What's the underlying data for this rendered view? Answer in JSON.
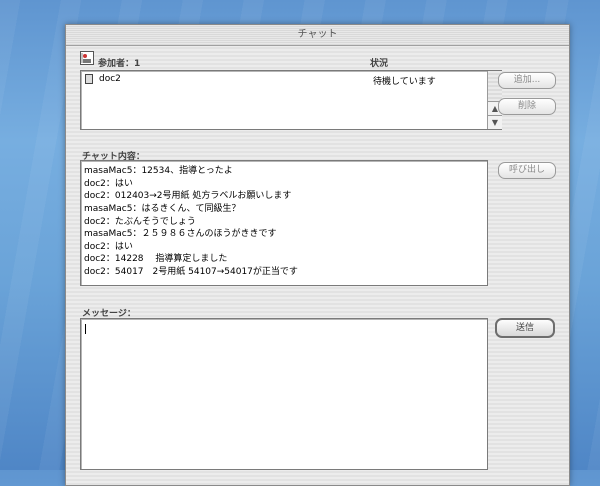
{
  "window": {
    "title": "チャット"
  },
  "participants": {
    "label": "参加者：1",
    "status_header": "状況",
    "rows": [
      {
        "name": "doc2",
        "status": "待機しています"
      }
    ]
  },
  "buttons": {
    "add": "追加...",
    "remove": "削除",
    "call": "呼び出し",
    "send": "送信"
  },
  "chat": {
    "label": "チャット内容：",
    "lines": [
      "masaMac5：12534、指導とったよ",
      "doc2：はい",
      "doc2：012403→2号用紙 処方ラベルお願いします",
      "masaMac5：はるきくん、て同級生？",
      "doc2：たぶんそうでしょう",
      "masaMac5：２５９８６さんのほうがききです",
      "doc2：はい",
      "doc2：14228　 指導算定しました",
      "doc2：54017　2号用紙 54107→54017が正当です"
    ]
  },
  "message": {
    "label": "メッセージ：",
    "value": ""
  }
}
